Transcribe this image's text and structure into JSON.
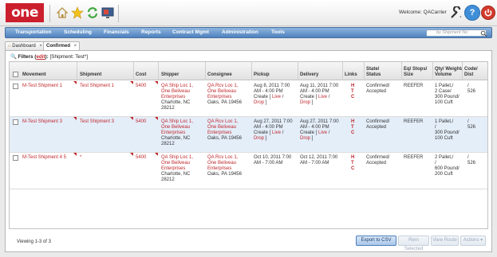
{
  "header": {
    "logo_text": "one",
    "welcome_text": "Welcome: QACarrier"
  },
  "nav": {
    "items": [
      "Transportation",
      "Scheduling",
      "Financials",
      "Reports",
      "Contract Mgmt",
      "Administration",
      "Tools"
    ],
    "search_placeholder": "by Shipment No"
  },
  "tabs": [
    {
      "label": "Dashboard",
      "close": "×"
    },
    {
      "label": "Confirmed",
      "close": "×"
    }
  ],
  "filters": {
    "prefix": "Filters (",
    "edit_label": "edit",
    "suffix": "):",
    "value": "[Shipment: Test*]"
  },
  "table": {
    "columns": [
      "Movement",
      "Shipment",
      "Cost",
      "Shipper",
      "Consignee",
      "Pickup",
      "Delivery",
      "Links",
      "State/ Status",
      "Eq/ Stops/ Size",
      "Qty/ Weight/ Volume",
      "Code/ Dist"
    ],
    "rows": [
      {
        "movement": "M-Test Shipment 1",
        "shipment": "Test Shipment 1",
        "cost": "5400",
        "shipper_links": [
          "QA Ship Loc 1,",
          "One Beliveau",
          "Enterprises"
        ],
        "shipper_addr": [
          "Charlotte, NC",
          "28212"
        ],
        "consignee_links": [
          "QA Rcv Loc 1,",
          "One Beliveau",
          "Enterprises"
        ],
        "consignee_addr": [
          "Oaks, PA 19456"
        ],
        "pickup": [
          "Aug 8, 2011 7:00",
          "AM - 4:00 PM",
          "Create [",
          "Live",
          "/",
          "Drop",
          "]"
        ],
        "delivery": [
          "Aug 11, 2011 7:00",
          "AM - 4:00 PM",
          "Create [",
          "Live",
          "/",
          "Drop",
          "]"
        ],
        "links": [
          "H",
          "T",
          "C"
        ],
        "status": [
          "Confirmed/",
          "Accepted"
        ],
        "eq": "REEFER",
        "qty": [
          "1 Pallet,/",
          "2 Case/",
          "300 Pound/",
          "100 Cuft"
        ],
        "code": [
          "/",
          "526"
        ]
      },
      {
        "movement": "M-Test Shipment 3",
        "shipment": "Test Shipment 3",
        "cost": "5400",
        "shipper_links": [
          "QA Ship Loc 1,",
          "One Beliveau",
          "Enterprises"
        ],
        "shipper_addr": [
          "Charlotte, NC",
          "28212"
        ],
        "consignee_links": [
          "QA Rcv Loc 1,",
          "One Beliveau",
          "Enterprises"
        ],
        "consignee_addr": [
          "Oaks, PA 19456"
        ],
        "pickup": [
          "Aug 27, 2011 7:00",
          "AM - 4:00 PM",
          "Create [",
          "Live",
          "/",
          "Drop",
          "]"
        ],
        "delivery": [
          "Aug 27, 2011 7:00",
          "AM - 4:00 PM",
          "Create [",
          "Live",
          "/",
          "Drop",
          "]"
        ],
        "links": [
          "H",
          "T",
          "C"
        ],
        "status": [
          "Confirmed/",
          "Accepted"
        ],
        "eq": "REEFER",
        "qty": [
          "1 Pallet,/",
          "/",
          "300 Pound/",
          "100 Cuft"
        ],
        "code": [
          "/",
          "526"
        ]
      },
      {
        "movement": "M-Test Shipment 4 5",
        "shipment": "*",
        "cost": "5400",
        "shipper_links": [
          "QA Ship Loc 1,",
          "One Beliveau",
          "Enterprises"
        ],
        "shipper_addr": [
          "Charlotte, NC",
          "28212"
        ],
        "consignee_links": [
          "QA Rcv Loc 1,",
          "One Beliveau",
          "Enterprises"
        ],
        "consignee_addr": [
          "Oaks, PA 19456"
        ],
        "pickup": [
          "Oct 10, 2011 7:00",
          "AM - 7:00 AM"
        ],
        "delivery": [
          "Oct 12, 2011 7:00",
          "AM - 7:00 AM"
        ],
        "links": [
          "H",
          "T",
          "C"
        ],
        "status": [
          "Confirmed/",
          "Accepted"
        ],
        "eq": "REEFER",
        "qty": [
          "2 Pallet,/",
          "/",
          "600 Pound/",
          "200 Cuft"
        ],
        "code": [
          "/",
          "526"
        ]
      }
    ]
  },
  "footer": {
    "viewing": "Viewing 1-3 of 3",
    "export_label": "Export to CSV",
    "buttons_disabled": [
      "Rem Selected",
      "View Route",
      "Actions"
    ]
  },
  "icons": [
    "home-icon",
    "star-icon",
    "refresh-icon",
    "screen-icon",
    "wrench-icon",
    "help-icon",
    "power-icon",
    "search-icon"
  ],
  "colors": {
    "brand_red": "#cc1f2d",
    "link_red": "#c0282d",
    "nav_blue": "#4f82bf",
    "selected_row": "#e4eef9"
  }
}
